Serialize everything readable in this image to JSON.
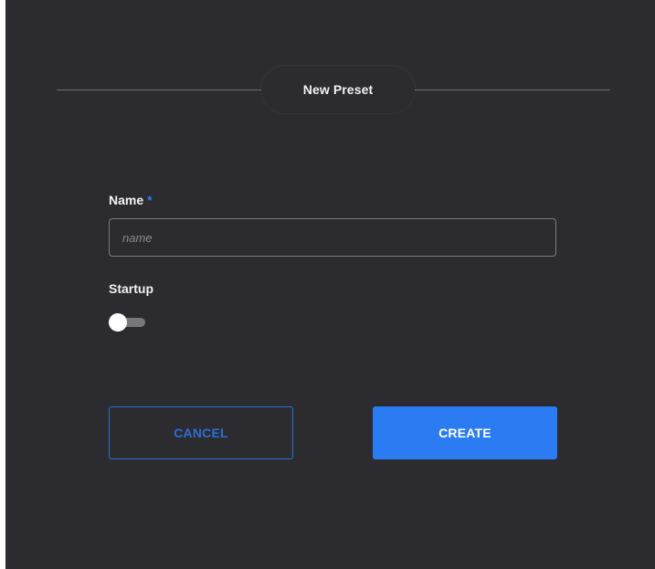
{
  "dialog": {
    "title": "New Preset",
    "name_field": {
      "label": "Name",
      "required_marker": "*",
      "placeholder": "name",
      "value": ""
    },
    "startup_field": {
      "label": "Startup",
      "enabled": false
    },
    "buttons": {
      "cancel_label": "CANCEL",
      "create_label": "CREATE"
    }
  },
  "colors": {
    "background": "#2b2b30",
    "accent": "#2b7cf2",
    "text": "#f2f2f2"
  }
}
